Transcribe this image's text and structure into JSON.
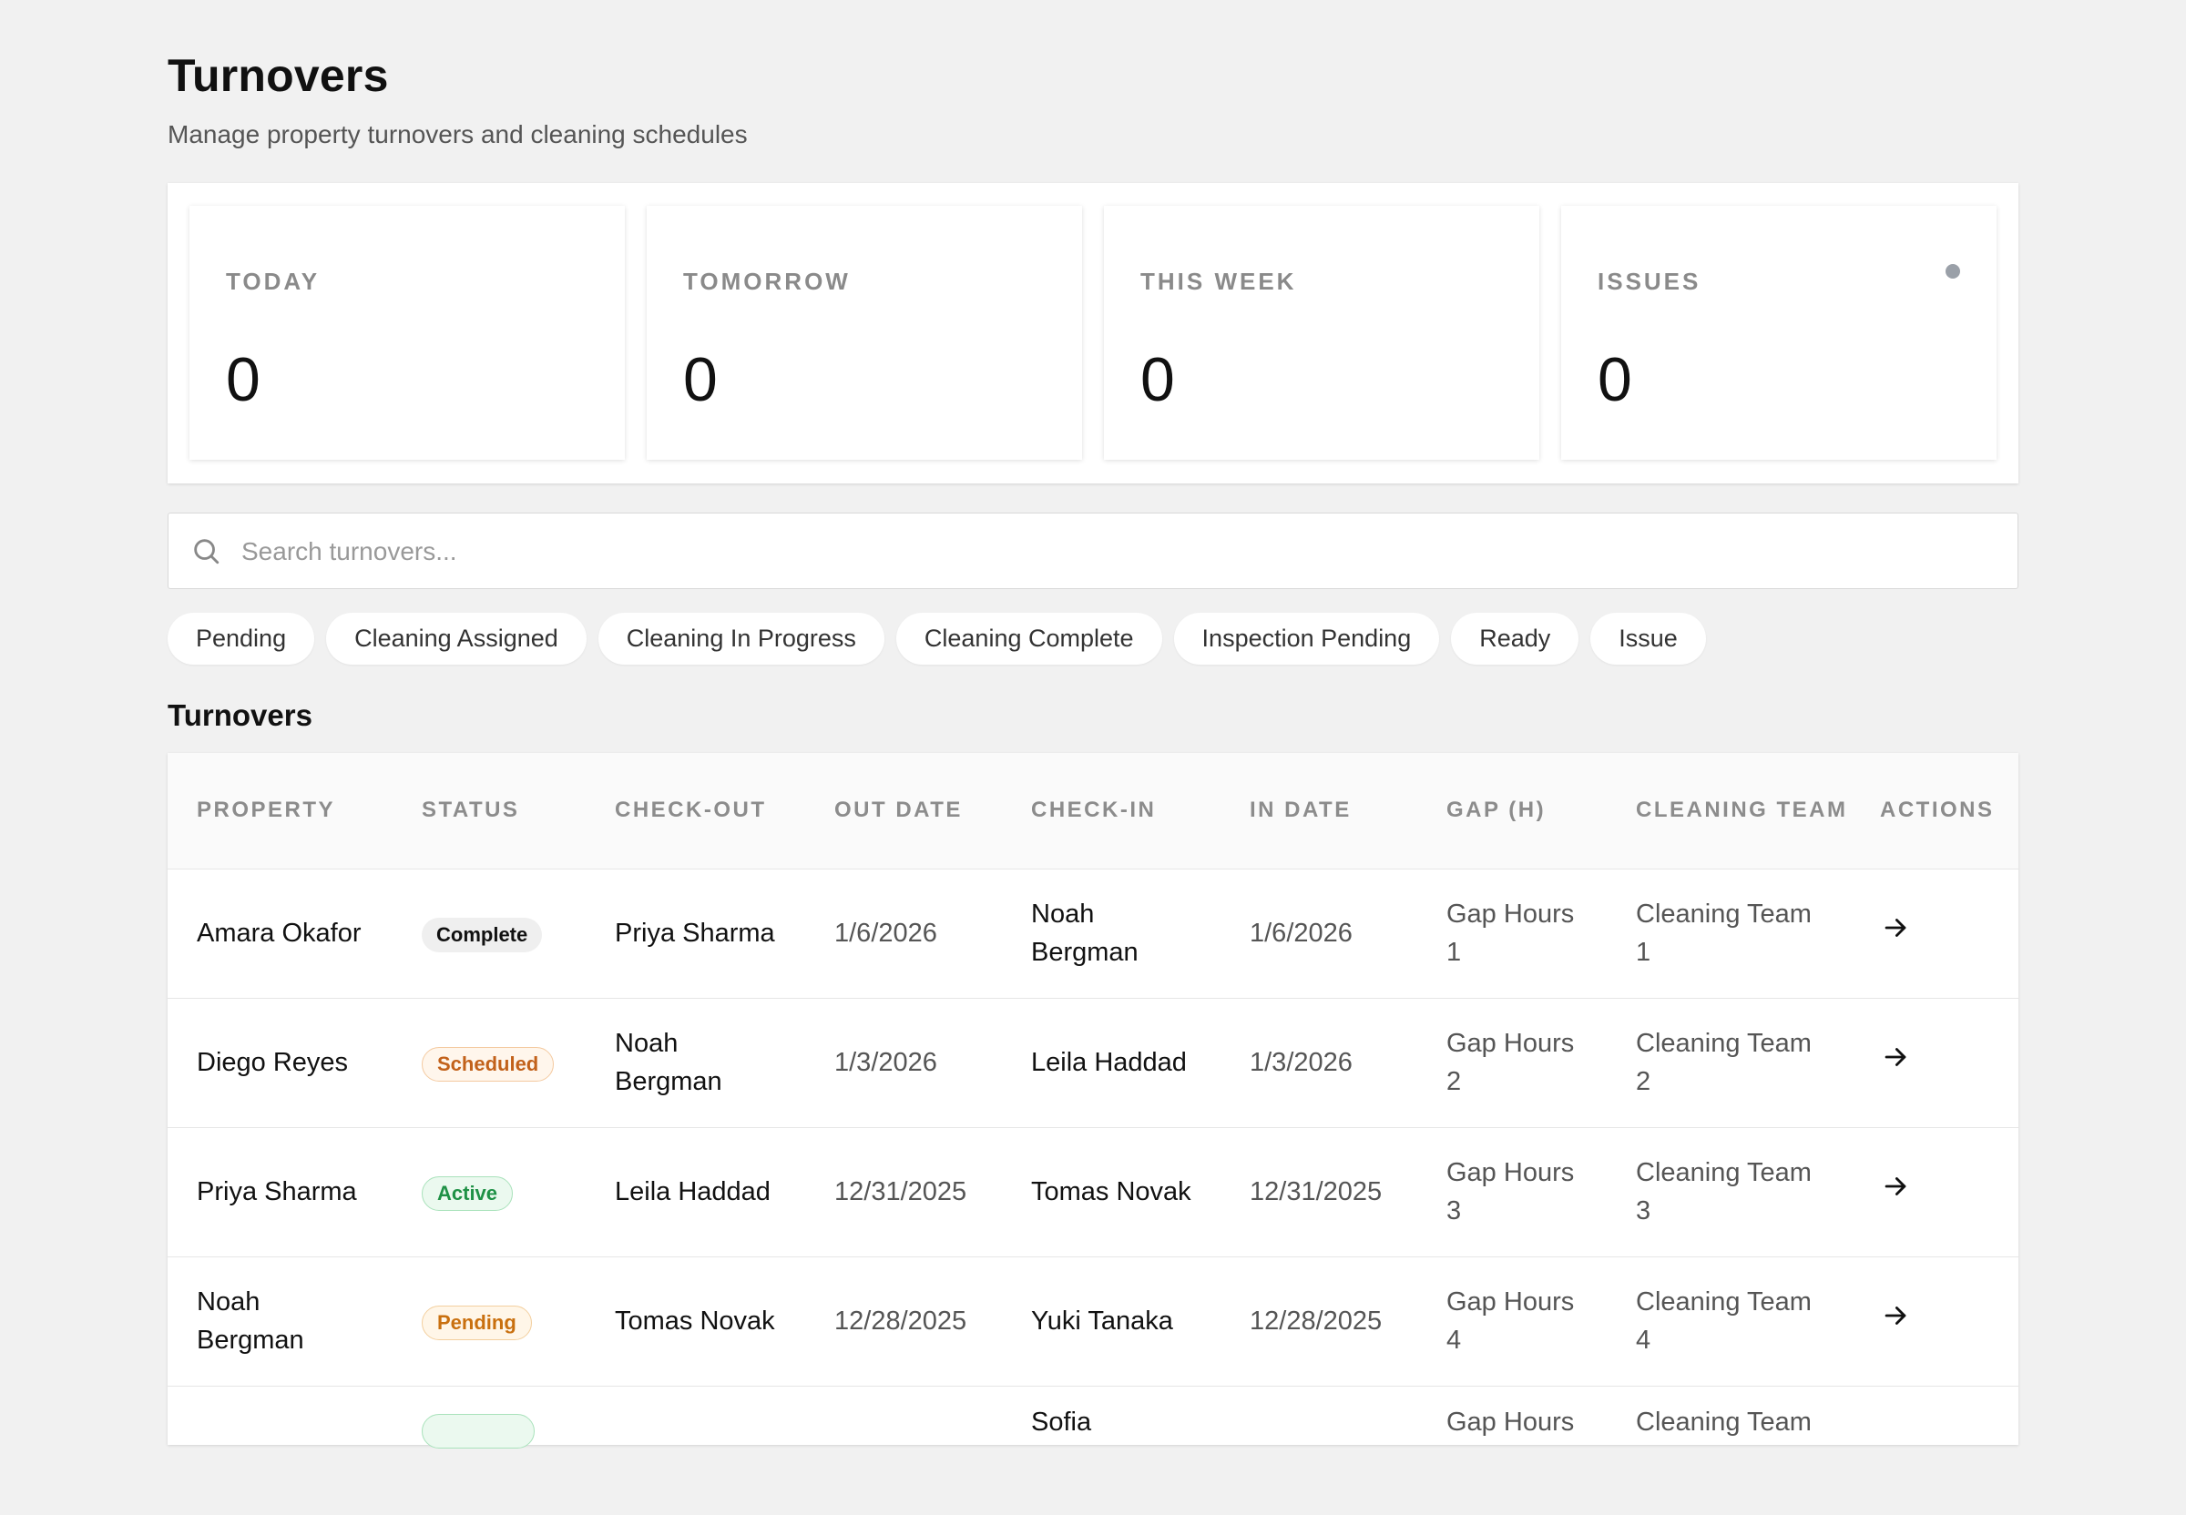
{
  "header": {
    "title": "Turnovers",
    "subtitle": "Manage property turnovers and cleaning schedules"
  },
  "stats": [
    {
      "label": "TODAY",
      "value": "0"
    },
    {
      "label": "TOMORROW",
      "value": "0"
    },
    {
      "label": "THIS WEEK",
      "value": "0"
    },
    {
      "label": "ISSUES",
      "value": "0"
    }
  ],
  "search": {
    "placeholder": "Search turnovers..."
  },
  "filters": [
    "Pending",
    "Cleaning Assigned",
    "Cleaning In Progress",
    "Cleaning Complete",
    "Inspection Pending",
    "Ready",
    "Issue"
  ],
  "table": {
    "title": "Turnovers",
    "columns": [
      "PROPERTY",
      "STATUS",
      "CHECK-OUT",
      "OUT DATE",
      "CHECK-IN",
      "IN DATE",
      "GAP (H)",
      "CLEANING TEAM",
      "ACTIONS"
    ],
    "rows": [
      {
        "property": "Amara Okafor",
        "status": "Complete",
        "checkout": "Priya Sharma",
        "out_date": "1/6/2026",
        "checkin": "Noah Bergman",
        "in_date": "1/6/2026",
        "gap": "Gap Hours 1",
        "team": "Cleaning Team 1"
      },
      {
        "property": "Diego Reyes",
        "status": "Scheduled",
        "checkout": "Noah Bergman",
        "out_date": "1/3/2026",
        "checkin": "Leila Haddad",
        "in_date": "1/3/2026",
        "gap": "Gap Hours 2",
        "team": "Cleaning Team 2"
      },
      {
        "property": "Priya Sharma",
        "status": "Active",
        "checkout": "Leila Haddad",
        "out_date": "12/31/2025",
        "checkin": "Tomas Novak",
        "in_date": "12/31/2025",
        "gap": "Gap Hours 3",
        "team": "Cleaning Team 3"
      },
      {
        "property": "Noah Bergman",
        "status": "Pending",
        "checkout": "Tomas Novak",
        "out_date": "12/28/2025",
        "checkin": "Yuki Tanaka",
        "in_date": "12/28/2025",
        "gap": "Gap Hours 4",
        "team": "Cleaning Team 4"
      },
      {
        "property": "",
        "status": "",
        "checkout": "",
        "out_date": "",
        "checkin": "Sofia",
        "in_date": "",
        "gap": "Gap Hours",
        "team": "Cleaning Team"
      }
    ]
  },
  "colors": {
    "accent_dot": "#9aa0a8",
    "scheduled": "#c2611a",
    "active": "#1f9146",
    "pending": "#c9700f"
  },
  "icons": {
    "search": "search-icon",
    "action": "arrow-right-icon",
    "issues_indicator": "dot-icon"
  }
}
